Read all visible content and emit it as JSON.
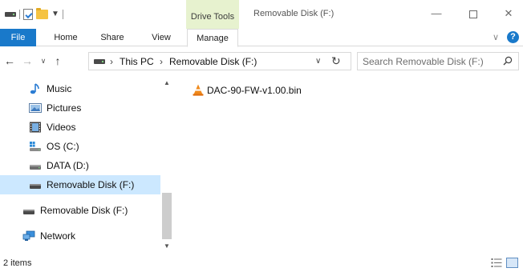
{
  "window": {
    "title": "Removable Disk (F:)",
    "contextual_tab_group": "Drive Tools"
  },
  "ribbon": {
    "tabs": [
      {
        "label": "File"
      },
      {
        "label": "Home"
      },
      {
        "label": "Share"
      },
      {
        "label": "View"
      },
      {
        "label": "Manage"
      }
    ]
  },
  "address_bar": {
    "breadcrumb": [
      "This PC",
      "Removable Disk (F:)"
    ]
  },
  "search": {
    "placeholder": "Search Removable Disk (F:)"
  },
  "nav_pane": {
    "items": [
      {
        "label": "Music",
        "icon": "music-icon"
      },
      {
        "label": "Pictures",
        "icon": "pictures-icon"
      },
      {
        "label": "Videos",
        "icon": "videos-icon"
      },
      {
        "label": "OS (C:)",
        "icon": "windows-drive-icon"
      },
      {
        "label": "DATA (D:)",
        "icon": "drive-icon"
      },
      {
        "label": "Removable Disk (F:)",
        "icon": "usb-drive-icon",
        "selected": true
      },
      {
        "label": "Removable Disk (F:)",
        "icon": "usb-drive-icon"
      },
      {
        "label": "Network",
        "icon": "network-icon"
      }
    ]
  },
  "content": {
    "files": [
      {
        "name": "DAC-90-FW-v1.00.bin",
        "icon": "vlc-icon"
      }
    ]
  },
  "status_bar": {
    "item_count": "2 items"
  },
  "colors": {
    "accent": "#1979ca",
    "selection": "#cce8ff",
    "contextual_tab": "#e7f2cf"
  }
}
